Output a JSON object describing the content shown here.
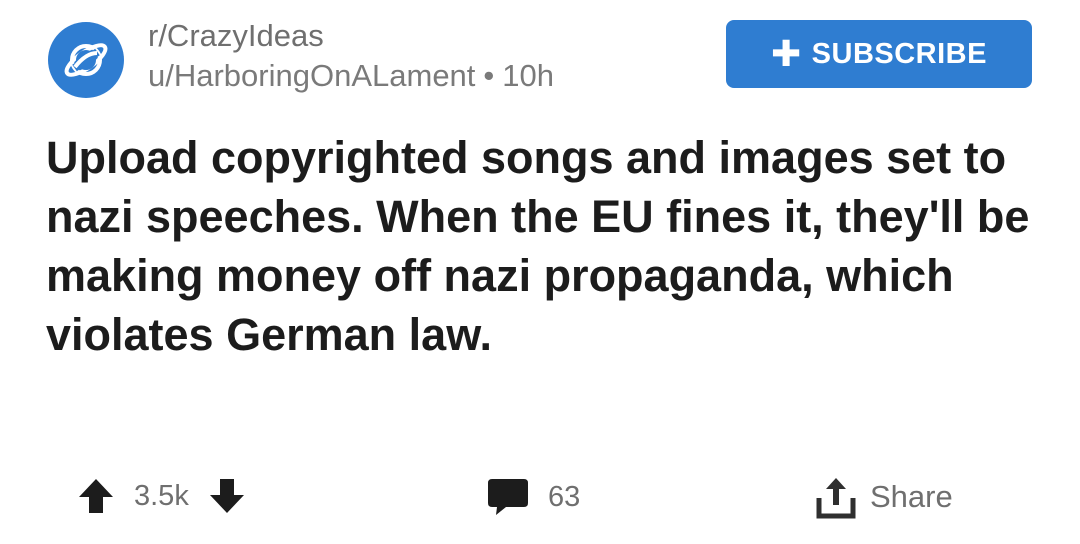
{
  "post": {
    "subreddit": "r/CrazyIdeas",
    "author": "u/HarboringOnALament",
    "separator": "•",
    "age": "10h",
    "title": "Upload copyrighted songs and images set to nazi speeches. When the EU fines it, they'll be making money off nazi propaganda, which violates German law."
  },
  "header": {
    "subscribe_label": "SUBSCRIBE",
    "subscribe_icon": "plus-icon",
    "avatar_icon": "planet-icon",
    "accent_color": "#2f7dd1"
  },
  "footer": {
    "score": "3.5k",
    "comments": "63",
    "share_label": "Share",
    "icons": [
      "upvote-arrow-icon",
      "downvote-arrow-icon",
      "comment-bubble-icon",
      "share-icon"
    ]
  }
}
